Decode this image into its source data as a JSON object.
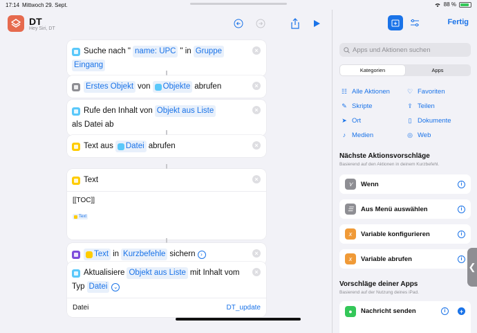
{
  "status": {
    "time": "17:14",
    "date": "Mittwoch 29. Sept.",
    "battery": "88 %"
  },
  "shortcut": {
    "title": "DT",
    "subtitle": "Hey Siri, DT"
  },
  "actions": [
    {
      "parts": [
        "Suche nach \"",
        "name: UPC",
        "\" in",
        "Gruppe",
        "Eingang"
      ]
    },
    {
      "parts": [
        "Erstes Objekt",
        "von",
        "Objekte",
        "abrufen"
      ]
    },
    {
      "parts": [
        "Rufe den Inhalt von",
        "Objekt aus Liste",
        "als Datei",
        "ab"
      ]
    },
    {
      "parts": [
        "Text aus",
        "Datei",
        "abrufen"
      ]
    },
    {
      "title": "Text",
      "content": "[[TOC]]",
      "variable": "Text"
    },
    {
      "parts": [
        "Text",
        "in",
        "Kurzbefehle",
        "sichern"
      ]
    },
    {
      "parts": [
        "Aktualisiere",
        "Objekt aus Liste",
        "mit Inhalt vom",
        "Typ",
        "Datei"
      ],
      "sub_label": "Datei",
      "sub_value": "DT_update"
    }
  ],
  "right": {
    "done": "Fertig",
    "search_placeholder": "Apps und Aktionen suchen",
    "seg_categories": "Kategorien",
    "seg_apps": "Apps",
    "categories": [
      "Alle Aktionen",
      "Favoriten",
      "Skripte",
      "Teilen",
      "Ort",
      "Dokumente",
      "Medien",
      "Web"
    ],
    "next_title": "Nächste Aktionsvorschläge",
    "next_sub": "Basierend auf den Aktionen in deinem Kurzbefehl.",
    "suggestions": [
      "Wenn",
      "Aus Menü auswählen",
      "Variable konfigurieren",
      "Variable abrufen"
    ],
    "apps_title": "Vorschläge deiner Apps",
    "apps_sub": "Basierend auf der Nutzung deines iPad.",
    "app_suggestion": "Nachricht senden"
  },
  "colors": {
    "accent": "#1a73e8",
    "app_icon": "#e66a4e"
  }
}
